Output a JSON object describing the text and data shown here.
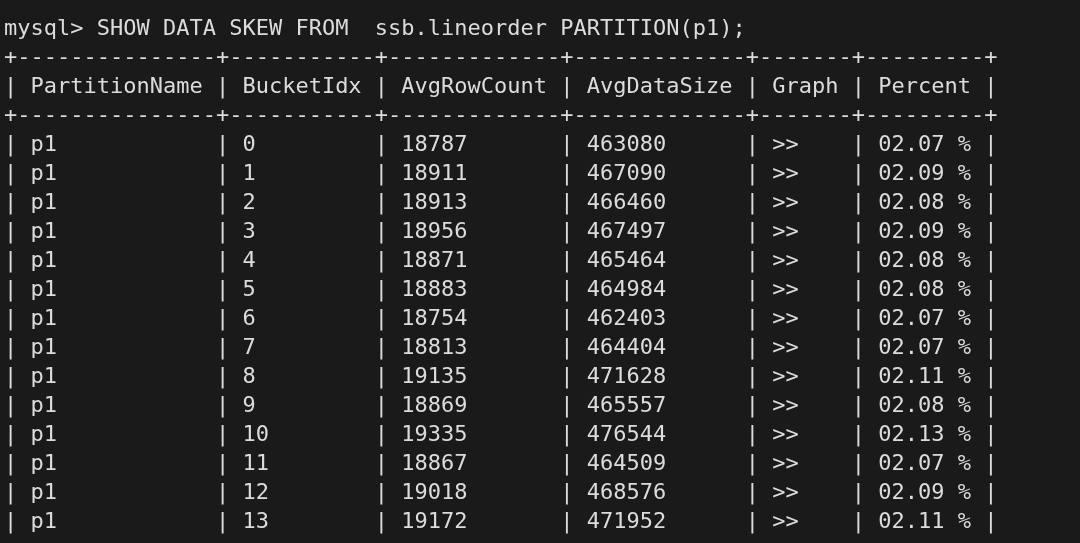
{
  "prompt": "mysql> SHOW DATA SKEW FROM  ssb.lineorder PARTITION(p1);",
  "lines": [
    "+---------------+-----------+-------------+-------------+-------+---------+",
    "| PartitionName | BucketIdx | AvgRowCount | AvgDataSize | Graph | Percent |",
    "+---------------+-----------+-------------+-------------+-------+---------+",
    "| p1            | 0         | 18787       | 463080      | >>    | 02.07 % |",
    "| p1            | 1         | 18911       | 467090      | >>    | 02.09 % |",
    "| p1            | 2         | 18913       | 466460      | >>    | 02.08 % |",
    "| p1            | 3         | 18956       | 467497      | >>    | 02.09 % |",
    "| p1            | 4         | 18871       | 465464      | >>    | 02.08 % |",
    "| p1            | 5         | 18883       | 464984      | >>    | 02.08 % |",
    "| p1            | 6         | 18754       | 462403      | >>    | 02.07 % |",
    "| p1            | 7         | 18813       | 464404      | >>    | 02.07 % |",
    "| p1            | 8         | 19135       | 471628      | >>    | 02.11 % |",
    "| p1            | 9         | 18869       | 465557      | >>    | 02.08 % |",
    "| p1            | 10        | 19335       | 476544      | >>    | 02.13 % |",
    "| p1            | 11        | 18867       | 464509      | >>    | 02.07 % |",
    "| p1            | 12        | 19018       | 468576      | >>    | 02.09 % |",
    "| p1            | 13        | 19172       | 471952      | >>    | 02.11 % |"
  ]
}
